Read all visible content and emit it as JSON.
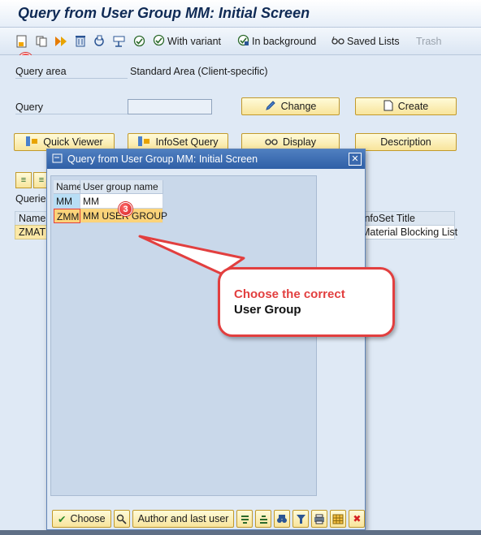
{
  "window": {
    "title": "Query from User Group MM: Initial Screen"
  },
  "toolbar": {
    "with_variant": "With variant",
    "in_background": "In background",
    "saved_lists": "Saved Lists",
    "trash": "Trash",
    "step_badge": "2"
  },
  "form": {
    "query_area_label": "Query area",
    "query_area_value": "Standard Area (Client-specific)",
    "query_label": "Query",
    "query_value": "",
    "change_btn": "Change",
    "create_btn": "Create",
    "quick_viewer_btn": "Quick Viewer",
    "infoset_query_btn": "InfoSet Query",
    "display_btn": "Display",
    "description_btn": "Description"
  },
  "queries_table": {
    "title": "Queries",
    "col_name": "Name",
    "col_infoset_title": "InfoSet Title",
    "row_name": "ZMATE",
    "row_infoset_title": "Material Blocking List"
  },
  "modal": {
    "title": "Query from User Group MM: Initial Screen",
    "columns": [
      "Name",
      "User group name"
    ],
    "rows": [
      {
        "name": "MM",
        "group": "MM"
      },
      {
        "name": "ZMM",
        "group": "MM USER GROUP"
      }
    ],
    "step_badge": "3",
    "choose_btn": "Choose",
    "author_btn": "Author and last user"
  },
  "callout": {
    "line1": "Choose the correct",
    "line2": "User Group"
  },
  "colors": {
    "title_bar": "#e6eef8",
    "modal_header": "#2f5fa6",
    "button_fill": "#f8e49b",
    "callout_red": "#e23f3f",
    "badge_red": "#d52222",
    "selected_row": "#fbd37a"
  },
  "icons": [
    "new-icon",
    "copy-icon",
    "execute-icon",
    "delete-icon",
    "export-icon",
    "transport-icon",
    "check-icon",
    "execute-variant-icon",
    "background-icon",
    "saved-lists-icon",
    "pencil-icon",
    "document-icon",
    "glasses-icon",
    "close-icon"
  ]
}
